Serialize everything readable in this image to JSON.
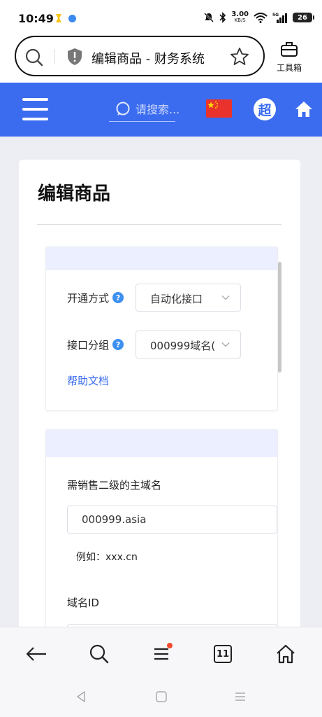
{
  "status_bar": {
    "time": "10:49",
    "net_speed": "3.00",
    "net_unit": "KB/S",
    "battery": "26",
    "icons": [
      "mute-icon",
      "bluetooth-icon",
      "wifi-icon",
      "5g-signal-icon",
      "battery-icon"
    ]
  },
  "browser": {
    "page_title": "编辑商品 - 财务系统",
    "toolbox_label": "工具箱"
  },
  "site_header": {
    "search_placeholder": "请搜索...",
    "avatar_text": "超",
    "colors": {
      "header_bg": "#3b6cf0",
      "flag": "#e8322b"
    }
  },
  "page": {
    "title": "编辑商品",
    "panel1": {
      "activation_label": "开通方式",
      "activation_value": "自动化接口",
      "group_label": "接口分组",
      "group_value": "000999域名(:",
      "help_link": "帮助文档"
    },
    "panel2": {
      "main_domain_label": "需销售二级的主域名",
      "main_domain_value": "000999.asia",
      "example_hint": "例如：xxx.cn",
      "domain_id_label": "域名ID"
    }
  },
  "bottom_nav": {
    "tab_count": "11",
    "items": [
      "back-icon",
      "search-icon",
      "menu-icon",
      "tabs-icon",
      "home-icon"
    ]
  },
  "system_nav": [
    "back-triangle-icon",
    "home-square-icon",
    "recents-icon"
  ]
}
